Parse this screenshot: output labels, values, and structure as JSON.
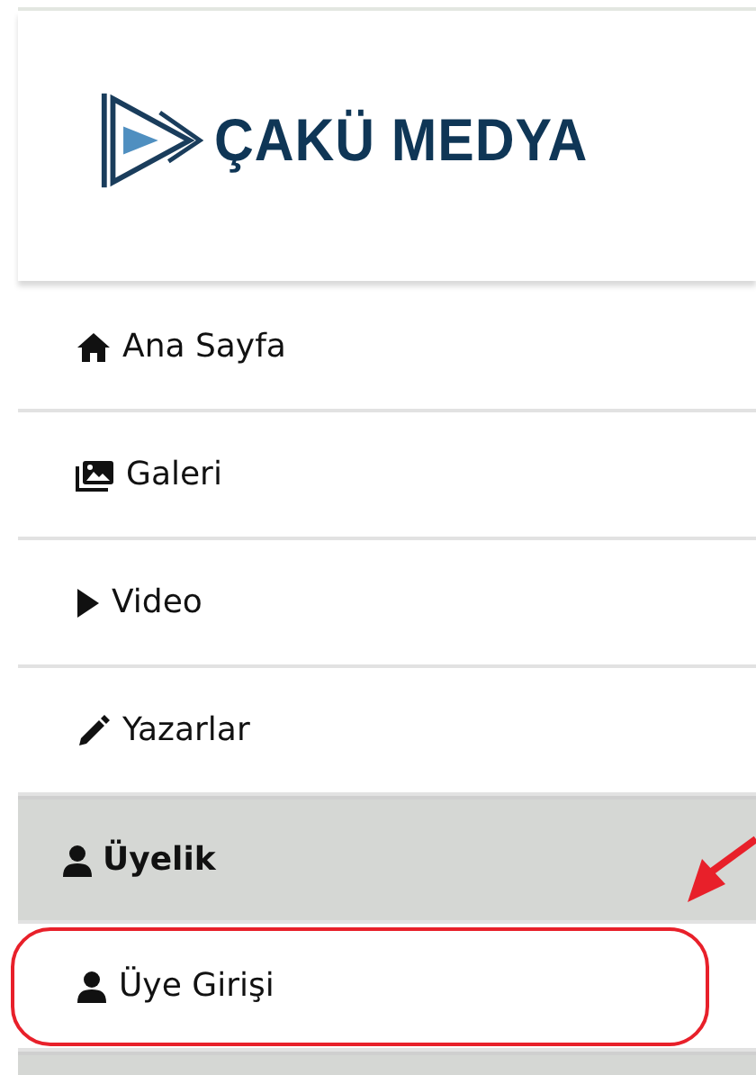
{
  "logo": {
    "text": "ÇAKÜ MEDYA"
  },
  "menu": [
    {
      "kind": "link",
      "label": "Ana Sayfa"
    },
    {
      "kind": "link",
      "label": "Galeri"
    },
    {
      "kind": "link",
      "label": "Video"
    },
    {
      "kind": "link",
      "label": "Yazarlar"
    },
    {
      "kind": "header",
      "label": "Üyelik"
    },
    {
      "kind": "link",
      "label": "Üye Girişi",
      "highlighted": true
    },
    {
      "kind": "header"
    }
  ]
}
